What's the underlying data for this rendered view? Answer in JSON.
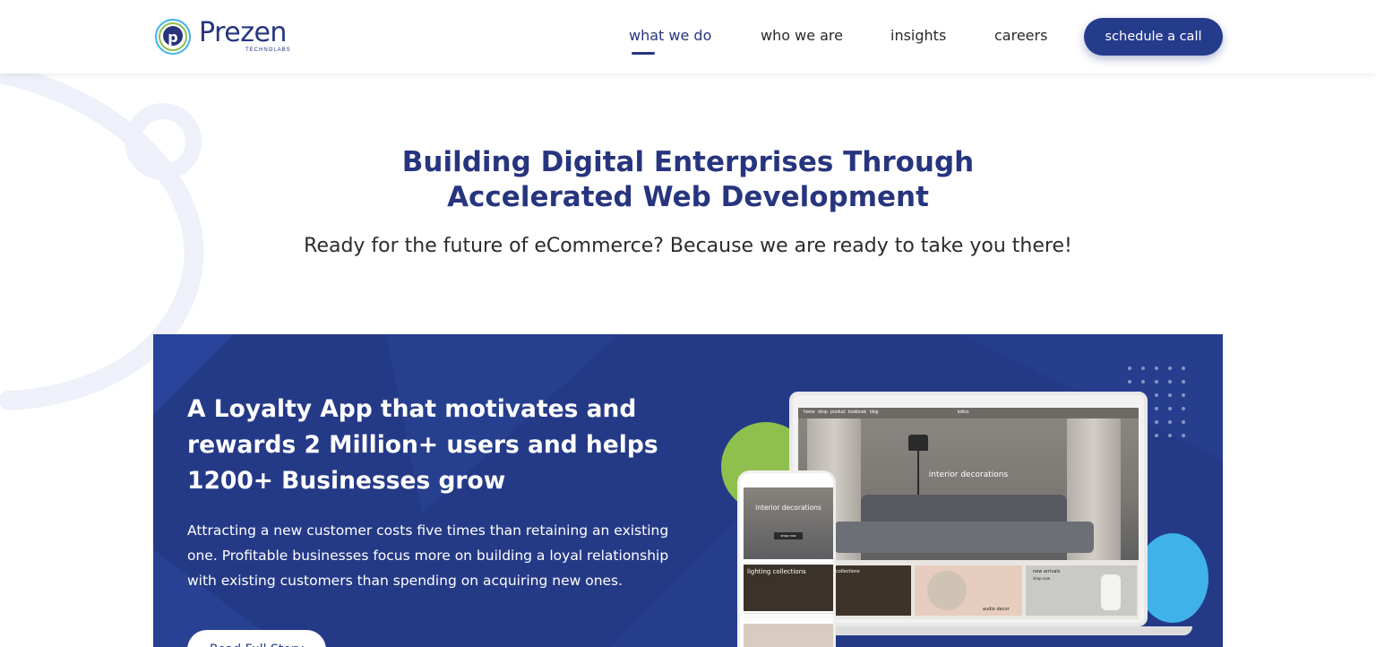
{
  "brand": {
    "name": "Prezen",
    "sub": "TECHNOLABS",
    "accent": "#27357e"
  },
  "nav": {
    "items": [
      {
        "label": "what we do",
        "active": true
      },
      {
        "label": "who we are",
        "active": false
      },
      {
        "label": "insights",
        "active": false
      },
      {
        "label": "careers",
        "active": false
      }
    ],
    "cta": "schedule a call"
  },
  "hero": {
    "title_line1": "Building Digital Enterprises Through",
    "title_line2": "Accelerated Web Development",
    "subtitle": "Ready for the future of eCommerce? Because we are ready to take you there!"
  },
  "banner": {
    "title": "A Loyalty App that motivates and rewards 2 Million+ users and helps 1200+ Businesses grow",
    "body": "Attracting a new customer costs five times than retaining an existing one. Profitable businesses focus more on building a loyal relationship with existing customers than spending on acquiring new ones.",
    "button": "Read Full Story",
    "colors": {
      "bg": "#253a87",
      "green": "#8fc04d",
      "blue": "#3fb2ea"
    }
  },
  "mockup": {
    "laptop_nav": [
      "home",
      "shop",
      "product",
      "lookbook",
      "blog"
    ],
    "laptop_brand": "kolics",
    "laptop_hero": "interior decorations",
    "laptop_tiles": [
      "collections",
      "audio decor",
      "new arrivals",
      "shop now"
    ],
    "phone_hero": "interior decorations",
    "phone_btn": "shop now",
    "phone_tile": "lighting collections"
  }
}
